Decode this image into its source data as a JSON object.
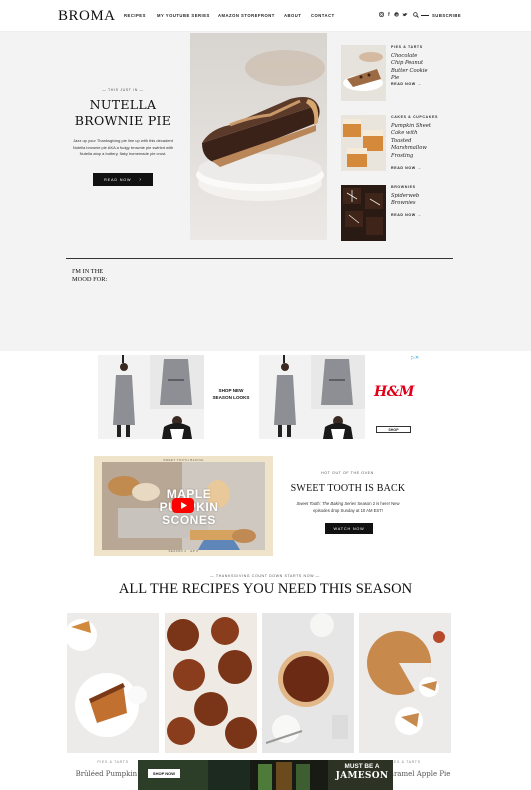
{
  "header": {
    "logo": "BROMA",
    "nav": [
      "RECIPES",
      "MY YOUTUBE SERIES",
      "AMAZON STOREFRONT",
      "ABOUT",
      "CONTACT"
    ],
    "social_icons": [
      "instagram-icon",
      "facebook-icon",
      "pinterest-icon",
      "twitter-icon"
    ],
    "search_icon": "search-icon",
    "subscribe": "SUBSCRIBE"
  },
  "hero": {
    "kicker": "— THIS JUST IN —",
    "title_line1": "NUTELLA",
    "title_line2": "BROWNIE PIE",
    "description": "Jazz up your Thanksgiving pie line up with this decadent Nutella brownie pie AKA a fudgy brownie pie swirled with Nutella atop a buttery, flaky homemade pie crust.",
    "button": "READ NOW"
  },
  "sidebar": [
    {
      "category": "PIES & TARTS",
      "title": "Chocolate Chip Peanut Butter Cookie Pie",
      "read": "READ NOW"
    },
    {
      "category": "CAKES & CUPCAKES",
      "title": "Pumpkin Sheet Cake with Toasted Marshmallow Frosting",
      "read": "READ NOW"
    },
    {
      "category": "BROWNIES",
      "title": "Spiderweb Brownies",
      "read": "READ NOW"
    }
  ],
  "mood": {
    "line1": "I'M IN THE",
    "line2": "MOOD FOR:"
  },
  "ad": {
    "text_line1": "SHOP NEW",
    "text_line2": "SEASON LOOKS",
    "brand": "H&M",
    "button": "SHOP",
    "choices_icon": "adchoices-icon"
  },
  "youtube": {
    "thumb_label_top": "SWEET TOOTH BAKING",
    "thumb_text_line1": "MAPLE",
    "thumb_text_line2": "PUMPKIN SCONES",
    "thumb_label_bottom": "SEASON 2 · EP 8",
    "kicker": "HOT OUT OF THE OVEN",
    "title": "SWEET TOOTH IS BACK",
    "desc_italic": "Sweet Tooth: The Baking Series",
    "desc_rest": " Season 2 is here! New episodes drop Sunday at 10 AM EST!",
    "button": "WATCH NOW"
  },
  "thanksgiving": {
    "kicker": "— THANKSGIVING COUNT DOWN STARTS NOW —",
    "title": "ALL THE RECIPES YOU NEED THIS SEASON"
  },
  "grid_captions": [
    {
      "category": "PIES & TARTS",
      "title": "Brûléed Pumpkin Pie"
    },
    {
      "category": "",
      "title": ""
    },
    {
      "category": "",
      "title": ""
    },
    {
      "category": "PIES & TARTS",
      "title": "Salted Caramel Apple Pie"
    }
  ],
  "bottom_ad": {
    "button": "SHOP NOW",
    "headline_line1": "MUST BE A",
    "headline_line2": "JAMESON"
  }
}
